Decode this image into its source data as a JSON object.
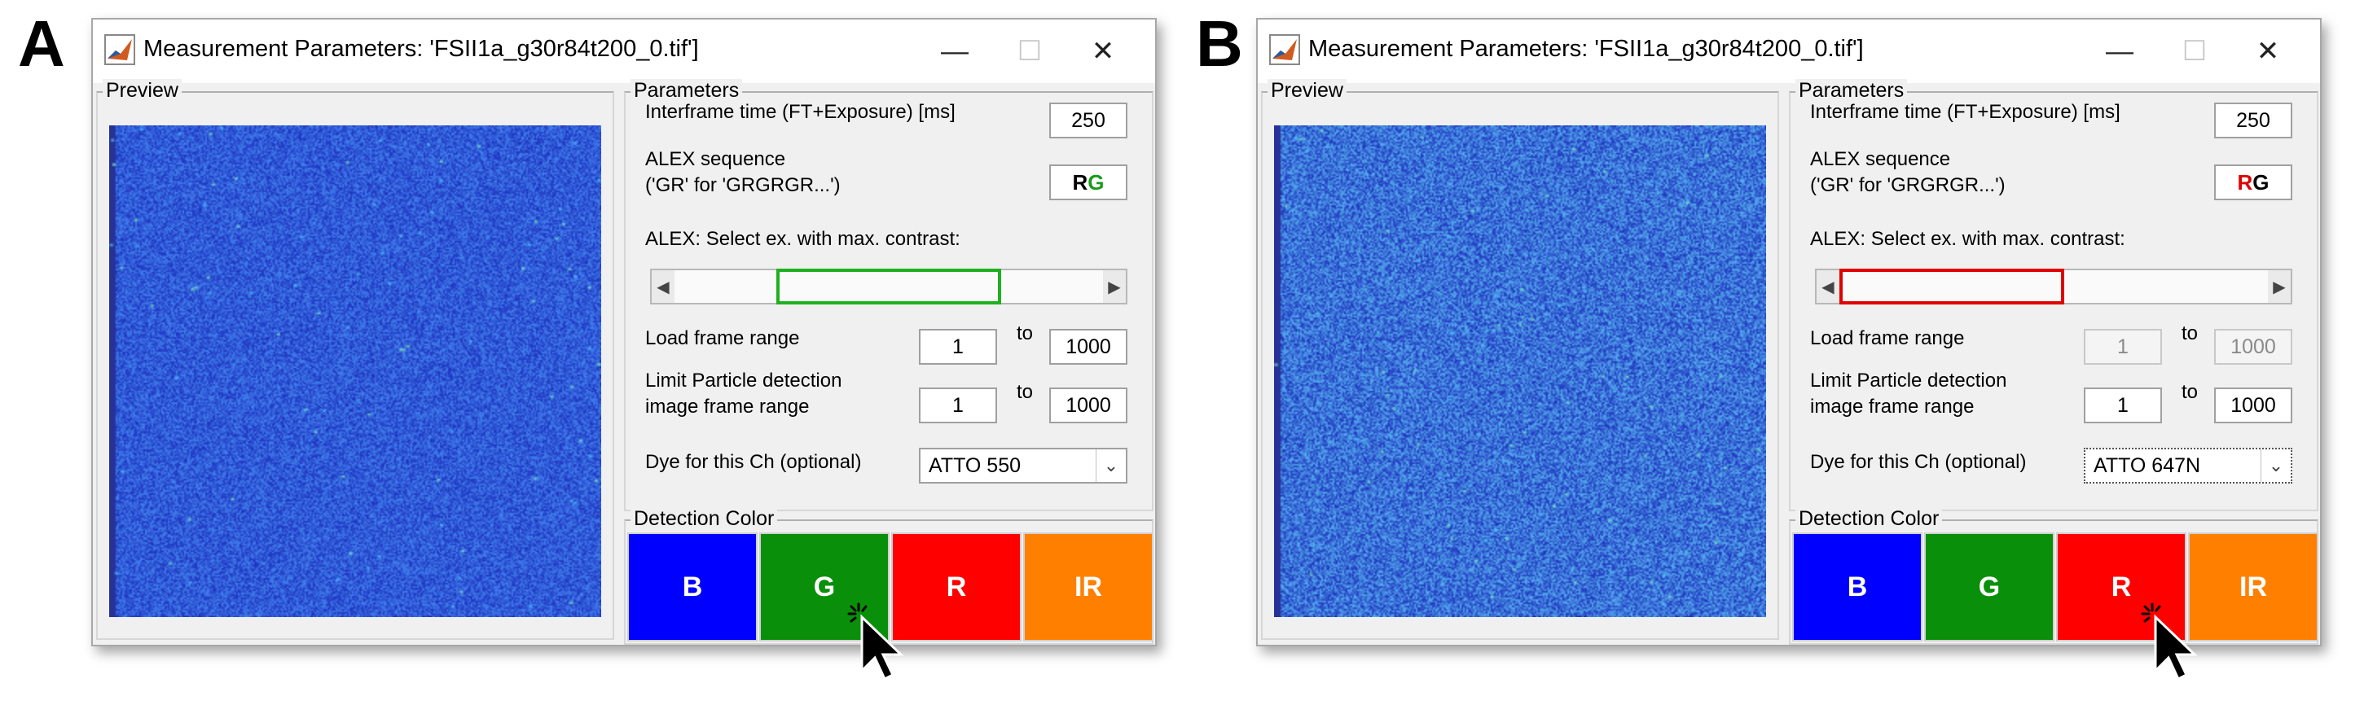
{
  "panels": [
    {
      "letter": "A",
      "window_title": "Measurement Parameters: 'FSII1a_g30r84t200_0.tif']",
      "preview_label": "Preview",
      "parameters_label": "Parameters",
      "interframe_label": "Interframe time (FT+Exposure) [ms]",
      "interframe_value": "250",
      "alex_seq_label_1": "ALEX sequence",
      "alex_seq_label_2": "('GR' for 'GRGRGR...')",
      "alex_seq_r": "R",
      "alex_seq_g": "G",
      "alex_seq_first_color": "#000000",
      "alex_seq_second_color": "#1a9a1a",
      "alex_select_label": "ALEX: Select ex. with max. contrast:",
      "slider_highlight_color": "#1fb01f",
      "slider_position": 0.5,
      "load_range_label": "Load frame range",
      "load_from": "1",
      "load_to": "1000",
      "load_disabled": false,
      "limit_label_1": "Limit Particle detection",
      "limit_label_2": "image frame range",
      "limit_from": "1",
      "limit_to": "1000",
      "to_label": "to",
      "dye_label": "Dye for this Ch (optional)",
      "dye_value": "ATTO 550",
      "detection_label": "Detection Color",
      "buttons": [
        {
          "label": "B",
          "color": "#0000ff"
        },
        {
          "label": "G",
          "color": "#0a8f0a"
        },
        {
          "label": "R",
          "color": "#ff0000"
        },
        {
          "label": "IR",
          "color": "#ff8000"
        }
      ],
      "clicked_button": "G"
    },
    {
      "letter": "B",
      "window_title": "Measurement Parameters: 'FSII1a_g30r84t200_0.tif']",
      "preview_label": "Preview",
      "parameters_label": "Parameters",
      "interframe_label": "Interframe time (FT+Exposure) [ms]",
      "interframe_value": "250",
      "alex_seq_label_1": "ALEX sequence",
      "alex_seq_label_2": "('GR' for 'GRGRGR...')",
      "alex_seq_r": "R",
      "alex_seq_g": "G",
      "alex_seq_first_color": "#e00000",
      "alex_seq_second_color": "#000000",
      "alex_select_label": "ALEX: Select ex. with max. contrast:",
      "slider_highlight_color": "#e00000",
      "slider_position": 0.0,
      "load_range_label": "Load frame range",
      "load_from": "1",
      "load_to": "1000",
      "load_disabled": true,
      "limit_label_1": "Limit Particle detection",
      "limit_label_2": "image frame range",
      "limit_from": "1",
      "limit_to": "1000",
      "to_label": "to",
      "dye_label": "Dye for this Ch (optional)",
      "dye_value": "ATTO 647N",
      "detection_label": "Detection Color",
      "buttons": [
        {
          "label": "B",
          "color": "#0000ff"
        },
        {
          "label": "G",
          "color": "#0a8f0a"
        },
        {
          "label": "R",
          "color": "#ff0000"
        },
        {
          "label": "IR",
          "color": "#ff8000"
        }
      ],
      "clicked_button": "R"
    }
  ],
  "icons": {
    "app": "matlab-icon",
    "minimize": "minimize-icon",
    "maximize": "maximize-icon",
    "close": "close-icon",
    "cursor": "click-cursor-icon"
  }
}
